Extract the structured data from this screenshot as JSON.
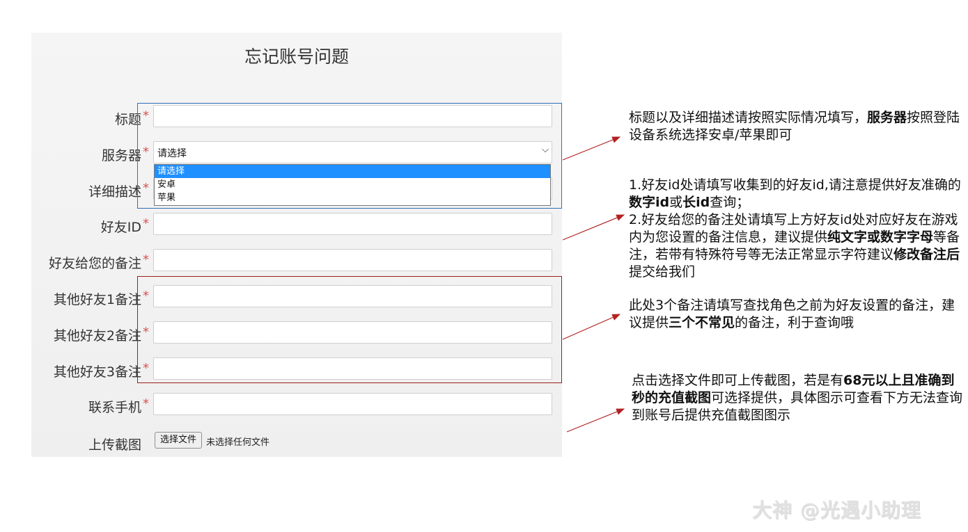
{
  "form": {
    "title": "忘记账号问题",
    "required_mark": "*",
    "fields": [
      {
        "label": "标题"
      },
      {
        "label": "服务器"
      },
      {
        "label": "详细描述"
      },
      {
        "label": "好友ID"
      },
      {
        "label": "好友给您的备注"
      },
      {
        "label": "其他好友1备注"
      },
      {
        "label": "其他好友2备注"
      },
      {
        "label": "其他好友3备注"
      },
      {
        "label": "联系手机"
      },
      {
        "label": "上传截图"
      }
    ],
    "server_select": {
      "selected": "请选择",
      "options": [
        "请选择",
        "安卓",
        "苹果"
      ]
    },
    "upload": {
      "button_label": "选择文件",
      "status": "未选择任何文件"
    }
  },
  "notes": {
    "note1": {
      "p1": "标题以及详细描述请按照实际情况填写，",
      "b1": "服务器",
      "p2": "按照登陆设备系统选择安卓/苹果即可"
    },
    "note2": {
      "p1": "1.好友id处请填写收集到的好友id,请注意提供好友准确的",
      "b1": "数字id",
      "p2": "或",
      "b2": "长id",
      "p3": "查询；",
      "p4": "2.好友给您的备注处请填写上方好友id处对应好友在游戏内为您设置的备注信息，建议提供",
      "b3": "纯文字或数字字母",
      "p5": "等备注，若带有特殊符号等无法正常显示字符建议",
      "b4": "修改备注后",
      "p6": "提交给我们"
    },
    "note3": {
      "p1": "此处3个备注请填写查找角色之前为好友设置的备注，建议提供",
      "b1": "三个不常见",
      "p2": "的备注，利于查询哦"
    },
    "note4": {
      "p1": "点击选择文件即可上传截图，若是有",
      "b1": "68元以上且准确到秒的充值截图",
      "p2": "可选择提供，具体图示可查看下方无法查询到账号后提供充值截图图示"
    }
  },
  "watermark": "大神 @光遇小助理",
  "colors": {
    "highlight_blue": "#2e6fb7",
    "highlight_red": "#9b1c1c",
    "required": "#d9534f",
    "option_selected": "#1e90ff"
  }
}
